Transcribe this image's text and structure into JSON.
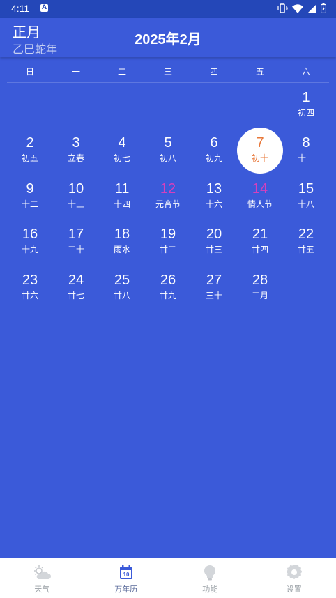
{
  "status": {
    "time": "4:11",
    "notification": "A"
  },
  "header": {
    "lunar_month": "正月",
    "lunar_year": "乙巳蛇年",
    "title": "2025年2月"
  },
  "weekdays": [
    "日",
    "一",
    "二",
    "三",
    "四",
    "五",
    "六"
  ],
  "days": [
    {
      "d": "",
      "s": ""
    },
    {
      "d": "",
      "s": ""
    },
    {
      "d": "",
      "s": ""
    },
    {
      "d": "",
      "s": ""
    },
    {
      "d": "",
      "s": ""
    },
    {
      "d": "",
      "s": ""
    },
    {
      "d": "1",
      "s": "初四"
    },
    {
      "d": "2",
      "s": "初五"
    },
    {
      "d": "3",
      "s": "立春"
    },
    {
      "d": "4",
      "s": "初七"
    },
    {
      "d": "5",
      "s": "初八"
    },
    {
      "d": "6",
      "s": "初九"
    },
    {
      "d": "7",
      "s": "初十",
      "today": true
    },
    {
      "d": "8",
      "s": "十一"
    },
    {
      "d": "9",
      "s": "十二"
    },
    {
      "d": "10",
      "s": "十三"
    },
    {
      "d": "11",
      "s": "十四"
    },
    {
      "d": "12",
      "s": "元宵节",
      "holiday": true
    },
    {
      "d": "13",
      "s": "十六"
    },
    {
      "d": "14",
      "s": "情人节",
      "holiday": true
    },
    {
      "d": "15",
      "s": "十八"
    },
    {
      "d": "16",
      "s": "十九"
    },
    {
      "d": "17",
      "s": "二十"
    },
    {
      "d": "18",
      "s": "雨水"
    },
    {
      "d": "19",
      "s": "廿二"
    },
    {
      "d": "20",
      "s": "廿三"
    },
    {
      "d": "21",
      "s": "廿四"
    },
    {
      "d": "22",
      "s": "廿五"
    },
    {
      "d": "23",
      "s": "廿六"
    },
    {
      "d": "24",
      "s": "廿七"
    },
    {
      "d": "25",
      "s": "廿八"
    },
    {
      "d": "26",
      "s": "廿九"
    },
    {
      "d": "27",
      "s": "三十"
    },
    {
      "d": "28",
      "s": "二月"
    }
  ],
  "nav": [
    {
      "label": "天气",
      "icon": "weather-icon"
    },
    {
      "label": "万年历",
      "icon": "calendar-icon",
      "badge": "10",
      "active": true
    },
    {
      "label": "功能",
      "icon": "lightbulb-icon"
    },
    {
      "label": "设置",
      "icon": "settings-icon"
    }
  ],
  "colors": {
    "background": "#3b5ad9",
    "statusbar": "#2447b8",
    "holiday": "#d63fbd",
    "today": "#e8783a"
  }
}
